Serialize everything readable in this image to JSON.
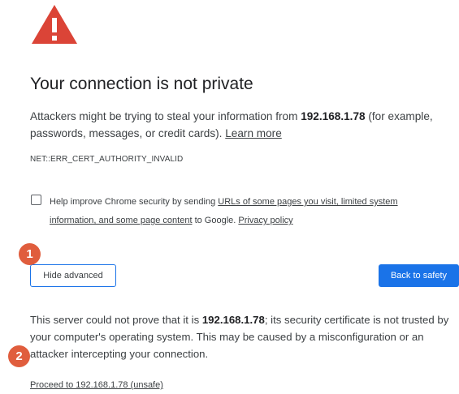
{
  "colors": {
    "warning_red": "#db4437",
    "primary_blue": "#1a73e8",
    "badge_orange": "#e05d3d",
    "text": "#3c4043"
  },
  "icons": {
    "warning": "warning-triangle-icon"
  },
  "heading": {
    "title": "Your connection is not private"
  },
  "intro": {
    "text_before": "Attackers might be trying to steal your information from ",
    "host": "192.168.1.78",
    "text_after": " (for example, passwords, messages, or credit cards). ",
    "learn_more": "Learn more"
  },
  "error_code": "NET::ERR_CERT_AUTHORITY_INVALID",
  "security_optin": {
    "text_before": "Help improve Chrome security by sending ",
    "link_text": "URLs of some pages you visit, limited system information, and some page content",
    "text_after": " to Google. ",
    "privacy_link": "Privacy policy"
  },
  "buttons": {
    "hide_advanced": "Hide advanced",
    "back_to_safety": "Back to safety"
  },
  "badges": {
    "first": "1",
    "second": "2"
  },
  "details": {
    "text_before": "This server could not prove that it is ",
    "host": "192.168.1.78",
    "text_after": "; its security certificate is not trusted by your computer's operating system. This may be caused by a misconfiguration or an attacker intercepting your connection."
  },
  "proceed_link": "Proceed to 192.168.1.78 (unsafe)"
}
